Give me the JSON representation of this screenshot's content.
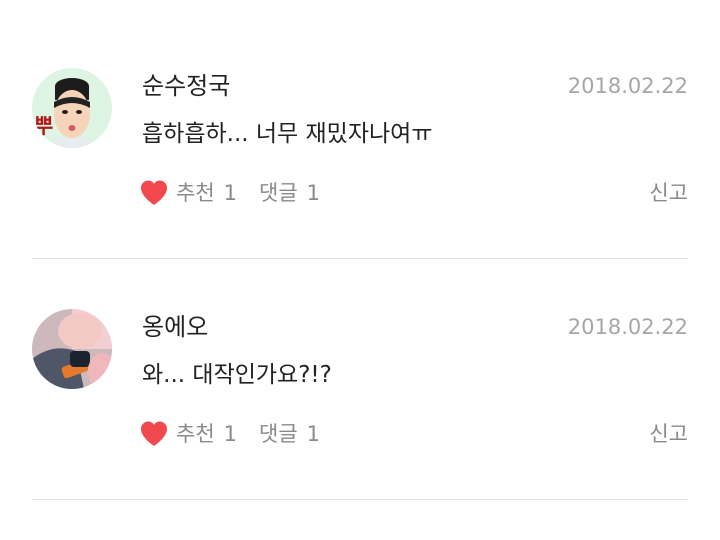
{
  "comments": [
    {
      "author": "순수정국",
      "date": "2018.02.22",
      "text": "흡하흡하... 너무 재밌자나여ㅠ",
      "like_label": "추천",
      "like_count": "1",
      "reply_label": "댓글",
      "reply_count": "1",
      "report_label": "신고",
      "avatar_sticker_text": "뿌"
    },
    {
      "author": "옹에오",
      "date": "2018.02.22",
      "text": "와... 대작인가요?!?",
      "like_label": "추천",
      "like_count": "1",
      "reply_label": "댓글",
      "reply_count": "1",
      "report_label": "신고"
    }
  ],
  "colors": {
    "heart": "#f0484c",
    "date": "#a6a6a6",
    "muted": "#8a8a8a",
    "divider": "#e3e3e3"
  },
  "icons": {
    "like": "heart-icon"
  }
}
